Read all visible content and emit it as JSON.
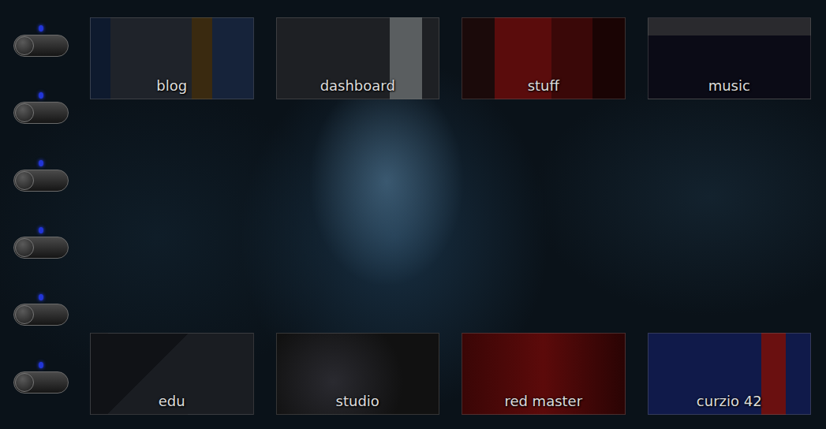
{
  "toggles": [
    {
      "on": false
    },
    {
      "on": false
    },
    {
      "on": false
    },
    {
      "on": false
    },
    {
      "on": false
    },
    {
      "on": false
    }
  ],
  "top_projects": [
    {
      "label": "blog"
    },
    {
      "label": "dashboard"
    },
    {
      "label": "stuff"
    },
    {
      "label": "music"
    }
  ],
  "bottom_projects": [
    {
      "label": "edu"
    },
    {
      "label": "studio"
    },
    {
      "label": "red master"
    },
    {
      "label": "curzio 42"
    }
  ]
}
